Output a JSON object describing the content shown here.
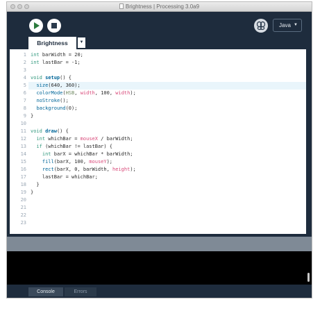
{
  "window": {
    "title": "Brightness | Processing 3.0a9"
  },
  "toolbar": {
    "run_label": "Run",
    "stop_label": "Stop",
    "mode": "Java"
  },
  "tabs": [
    {
      "label": "Brightness",
      "active": true
    }
  ],
  "editor": {
    "highlighted_line": 5,
    "line_numbers": [
      "1",
      "2",
      "3",
      "4",
      "5",
      "6",
      "7",
      "8",
      "9",
      "10",
      "11",
      "12",
      "13",
      "14",
      "15",
      "16",
      "17",
      "18",
      "19",
      "20",
      "21",
      "22",
      "23"
    ],
    "lines": [
      [
        {
          "t": "int",
          "c": "kw"
        },
        {
          "t": " barWidth = 20;"
        }
      ],
      [
        {
          "t": "int",
          "c": "kw"
        },
        {
          "t": " lastBar = -1;"
        }
      ],
      [],
      [
        {
          "t": "void",
          "c": "kw"
        },
        {
          "t": " "
        },
        {
          "t": "setup",
          "c": "fn"
        },
        {
          "t": "() {"
        }
      ],
      [
        {
          "t": "  "
        },
        {
          "t": "size",
          "c": "call"
        },
        {
          "t": "(640, 360);"
        }
      ],
      [
        {
          "t": "  "
        },
        {
          "t": "colorMode",
          "c": "call"
        },
        {
          "t": "("
        },
        {
          "t": "HSB",
          "c": "const"
        },
        {
          "t": ", "
        },
        {
          "t": "width",
          "c": "var"
        },
        {
          "t": ", 100, "
        },
        {
          "t": "width",
          "c": "var"
        },
        {
          "t": ");"
        }
      ],
      [
        {
          "t": "  "
        },
        {
          "t": "noStroke",
          "c": "call"
        },
        {
          "t": "();"
        }
      ],
      [
        {
          "t": "  "
        },
        {
          "t": "background",
          "c": "call"
        },
        {
          "t": "(0);"
        }
      ],
      [
        {
          "t": "}"
        }
      ],
      [],
      [
        {
          "t": "void",
          "c": "kw"
        },
        {
          "t": " "
        },
        {
          "t": "draw",
          "c": "fn"
        },
        {
          "t": "() {"
        }
      ],
      [
        {
          "t": "  "
        },
        {
          "t": "int",
          "c": "kw"
        },
        {
          "t": " whichBar = "
        },
        {
          "t": "mouseX",
          "c": "var"
        },
        {
          "t": " / barWidth;"
        }
      ],
      [
        {
          "t": "  "
        },
        {
          "t": "if",
          "c": "kw"
        },
        {
          "t": " (whichBar != lastBar) {"
        }
      ],
      [
        {
          "t": "    "
        },
        {
          "t": "int",
          "c": "kw"
        },
        {
          "t": " barX = whichBar * barWidth;"
        }
      ],
      [
        {
          "t": "    "
        },
        {
          "t": "fill",
          "c": "call"
        },
        {
          "t": "(barX, 100, "
        },
        {
          "t": "mouseY",
          "c": "var"
        },
        {
          "t": ");"
        }
      ],
      [
        {
          "t": "    "
        },
        {
          "t": "rect",
          "c": "call"
        },
        {
          "t": "(barX, 0, barWidth, "
        },
        {
          "t": "height",
          "c": "var"
        },
        {
          "t": ");"
        }
      ],
      [
        {
          "t": "    lastBar = whichBar;"
        }
      ],
      [
        {
          "t": "  }"
        }
      ],
      [
        {
          "t": "}"
        }
      ],
      [],
      [],
      [],
      []
    ]
  },
  "bottom_tabs": [
    {
      "label": "Console",
      "active": true
    },
    {
      "label": "Errors",
      "active": false
    }
  ],
  "colors": {
    "chrome": "#1e2c3d",
    "keyword": "#33997e",
    "function": "#006699",
    "builtin_var": "#d94a7a",
    "constant": "#718a62"
  }
}
